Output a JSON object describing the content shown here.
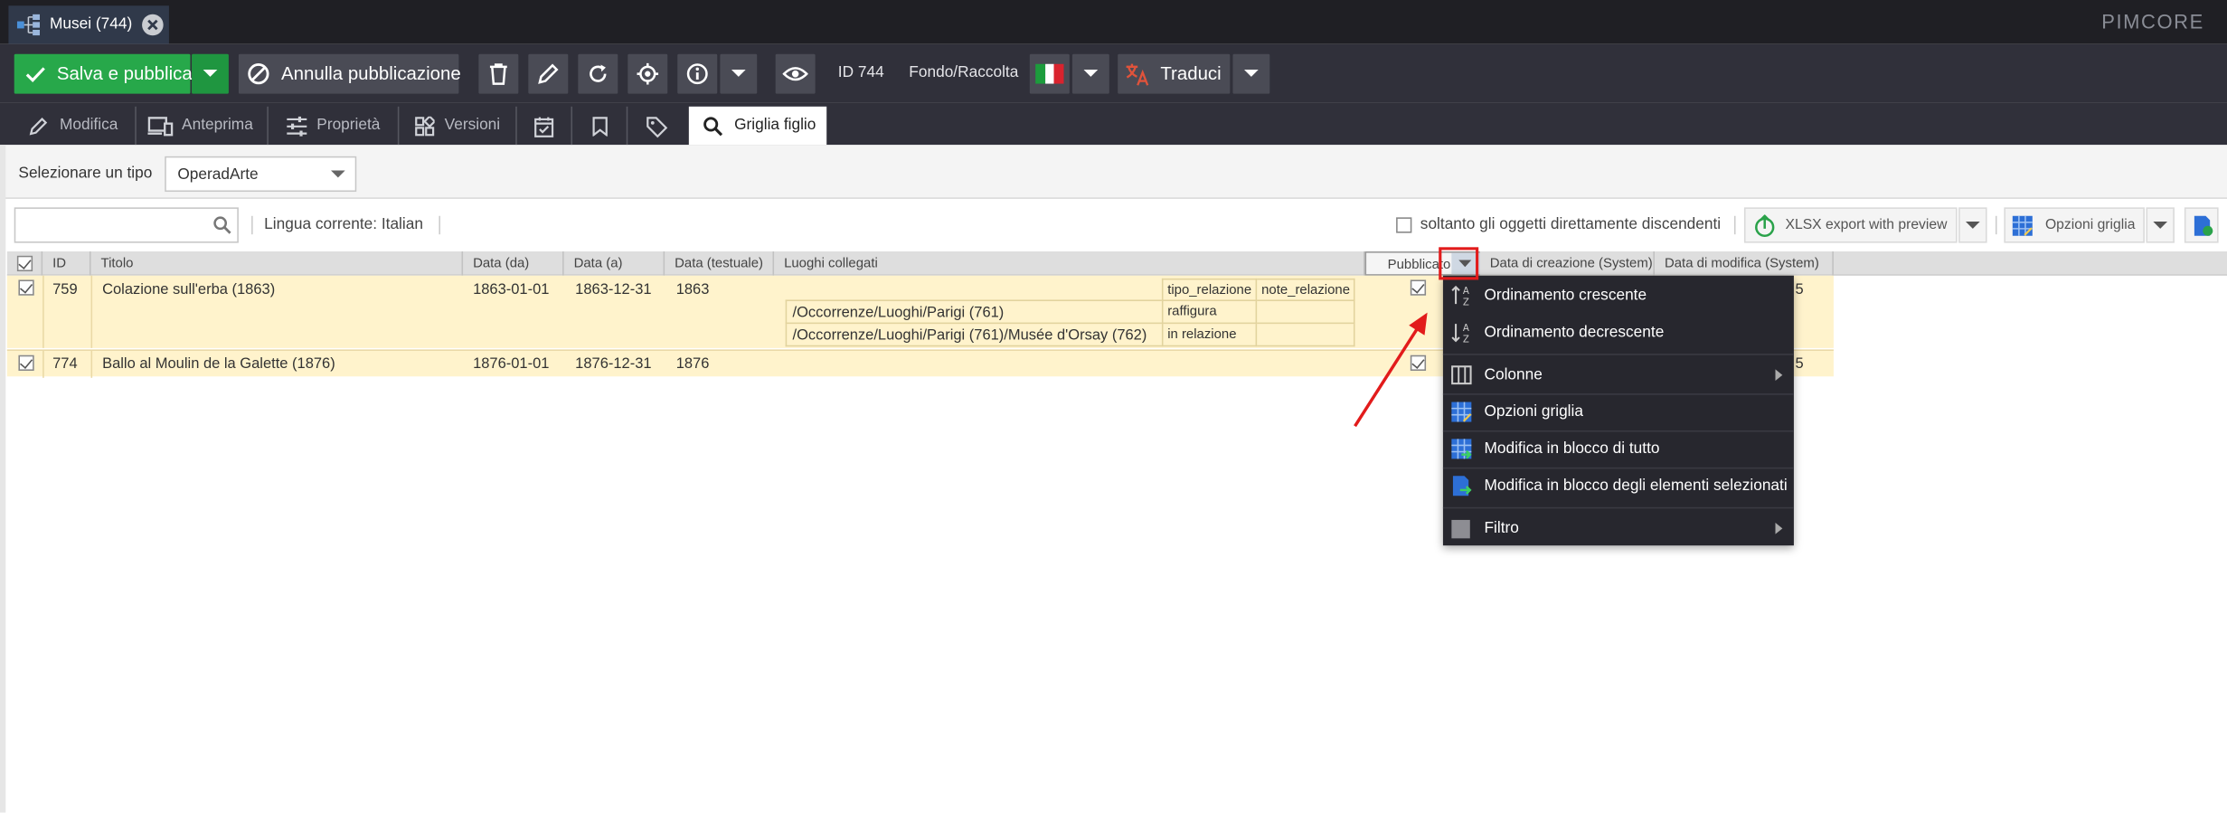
{
  "document_tab": {
    "title": "Musei (744)"
  },
  "brand": {
    "logo": "PIMCORE"
  },
  "toolbar": {
    "save_publish": "Salva e pubblica",
    "unpublish": "Annulla pubblicazione",
    "id_label": "ID 744",
    "class_label": "Fondo/Raccolta",
    "translate": "Traduci"
  },
  "tabs": [
    {
      "label": "Modifica",
      "icon": "pencil-icon"
    },
    {
      "label": "Anteprima",
      "icon": "devices-icon"
    },
    {
      "label": "Proprietà",
      "icon": "sliders-icon"
    },
    {
      "label": "Versioni",
      "icon": "versions-icon"
    },
    {
      "label": "",
      "icon": "calendar-check-icon"
    },
    {
      "label": "",
      "icon": "bookmark-icon"
    },
    {
      "label": "",
      "icon": "tag-icon"
    },
    {
      "label": "Griglia figlio",
      "icon": "search-icon"
    }
  ],
  "type_select": {
    "label": "Selezionare un tipo",
    "value": "OperadArte"
  },
  "search": {
    "placeholder": "",
    "current_language": "Lingua corrente: Italian",
    "only_direct_children": "soltanto gli oggetti direttamente discendenti",
    "xlsx_export": "XLSX export with preview",
    "grid_options": "Opzioni griglia"
  },
  "grid": {
    "columns": [
      "ID",
      "Titolo",
      "Data (da)",
      "Data (a)",
      "Data (testuale)",
      "Luoghi collegati",
      "Pubblicato",
      "Data di creazione (System)",
      "Data di modifica (System)"
    ],
    "rows": [
      {
        "id": "759",
        "title": "Colazione sull'erba (1863)",
        "date_from": "1863-01-01",
        "date_to": "1863-12-31",
        "date_text": "1863",
        "places_header": [
          "tipo_relazione",
          "note_relazione"
        ],
        "places": [
          {
            "path": "/Occorrenze/Luoghi/Parigi (761)",
            "type": "raffigura",
            "note": ""
          },
          {
            "path": "/Occorrenze/Luoghi/Parigi (761)/Musée d'Orsay (762)",
            "type": "in relazione",
            "note": ""
          }
        ],
        "modified_tail": "5"
      },
      {
        "id": "774",
        "title": "Ballo al Moulin de la Galette (1876)",
        "date_from": "1876-01-01",
        "date_to": "1876-12-31",
        "date_text": "1876",
        "modified_tail": "5"
      }
    ]
  },
  "context_menu": {
    "items": [
      {
        "label": "Ordinamento crescente",
        "icon": "sort-asc-icon"
      },
      {
        "label": "Ordinamento decrescente",
        "icon": "sort-desc-icon"
      },
      {
        "label": "Colonne",
        "icon": "columns-icon"
      },
      {
        "label": "Opzioni griglia",
        "icon": "grid-options-icon"
      },
      {
        "label": "Modifica in blocco di tutto",
        "icon": "batch-edit-all-icon"
      },
      {
        "label": "Modifica in blocco degli elementi selezionati",
        "icon": "batch-edit-selected-icon"
      },
      {
        "label": "Filtro",
        "icon": "filter-icon"
      }
    ]
  },
  "colors": {
    "accent_green": "#27a84a",
    "toolbar_bg": "#30303a",
    "highlight_red": "#e21b1b",
    "row_highlight": "#fff3cc"
  }
}
